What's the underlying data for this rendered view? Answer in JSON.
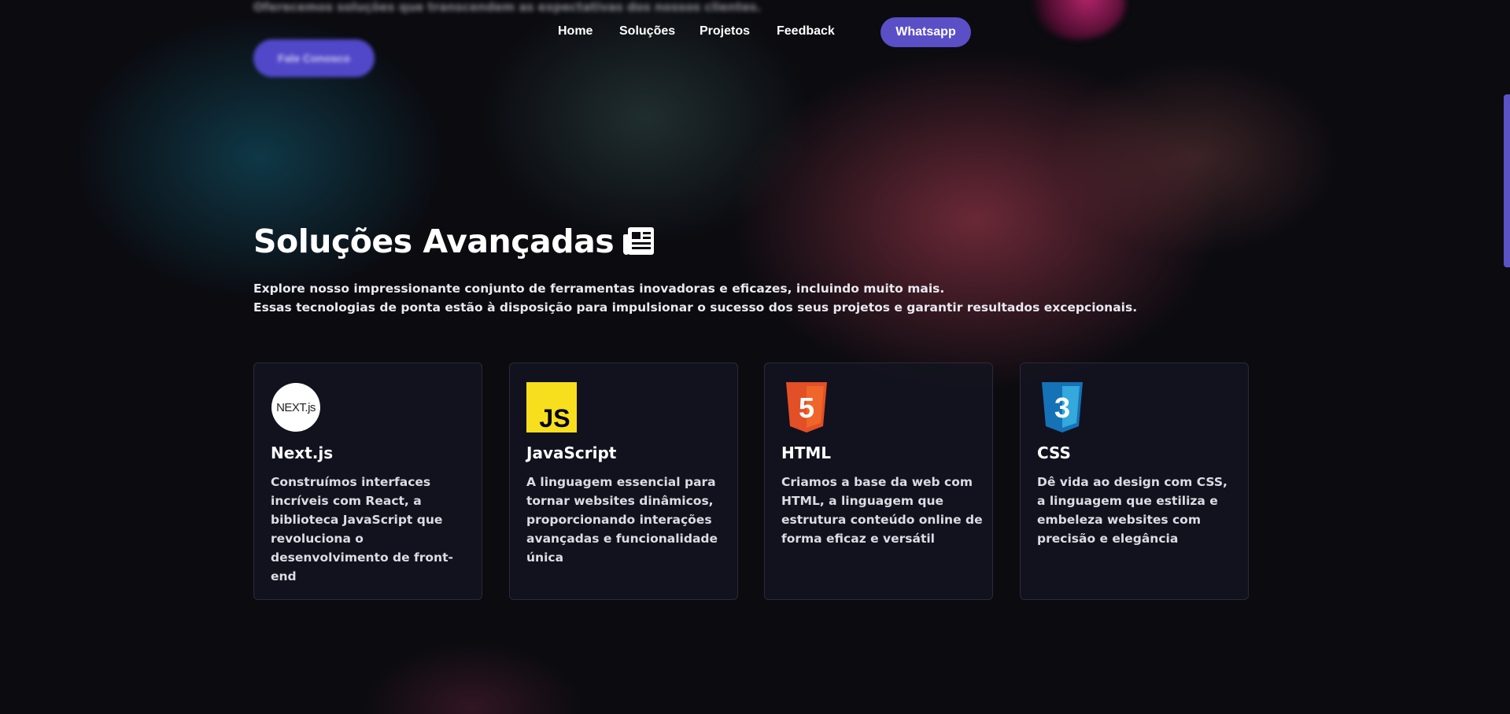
{
  "hero": {
    "blurred_text": "Oferecemos soluções que transcendem as expectativas dos nossos clientes.",
    "blurred_button": "Fale Conosco"
  },
  "nav": {
    "items": [
      "Home",
      "Soluções",
      "Projetos",
      "Feedback"
    ],
    "whatsapp": "Whatsapp"
  },
  "section": {
    "title": "Soluções Avançadas",
    "title_icon": "newspaper-icon",
    "description_lines": [
      "Explore nosso impressionante conjunto de ferramentas inovadoras e eficazes, incluindo muito mais.",
      "Essas tecnologias de ponta estão à disposição para impulsionar o sucesso dos seus projetos e garantir resultados excepcionais."
    ]
  },
  "cards": [
    {
      "icon": "nextjs-logo",
      "logo_text": "NEXT.js",
      "title": "Next.js",
      "description": "Construímos interfaces incríveis com React, a biblioteca JavaScript que revoluciona o desenvolvimento de front-end"
    },
    {
      "icon": "javascript-logo",
      "logo_text": "JS",
      "title": "JavaScript",
      "description": "A linguagem essencial para tornar websites dinâmicos, proporcionando interações avançadas e funcionalidade única"
    },
    {
      "icon": "html5-logo",
      "logo_text": "5",
      "title": "HTML",
      "description": "Criamos a base da web com HTML, a linguagem que estrutura conteúdo online de forma eficaz e versátil"
    },
    {
      "icon": "css3-logo",
      "logo_text": "3",
      "title": "CSS",
      "description": "Dê vida ao design com CSS, a linguagem que estiliza e embeleza websites com precisão e elegância"
    }
  ],
  "colors": {
    "accent": "#5a4fc6",
    "background": "#0b0b10",
    "card_bg": "#14141f",
    "js_yellow": "#f7df1e",
    "html_orange": "#e34f26",
    "css_blue": "#1572b6"
  }
}
